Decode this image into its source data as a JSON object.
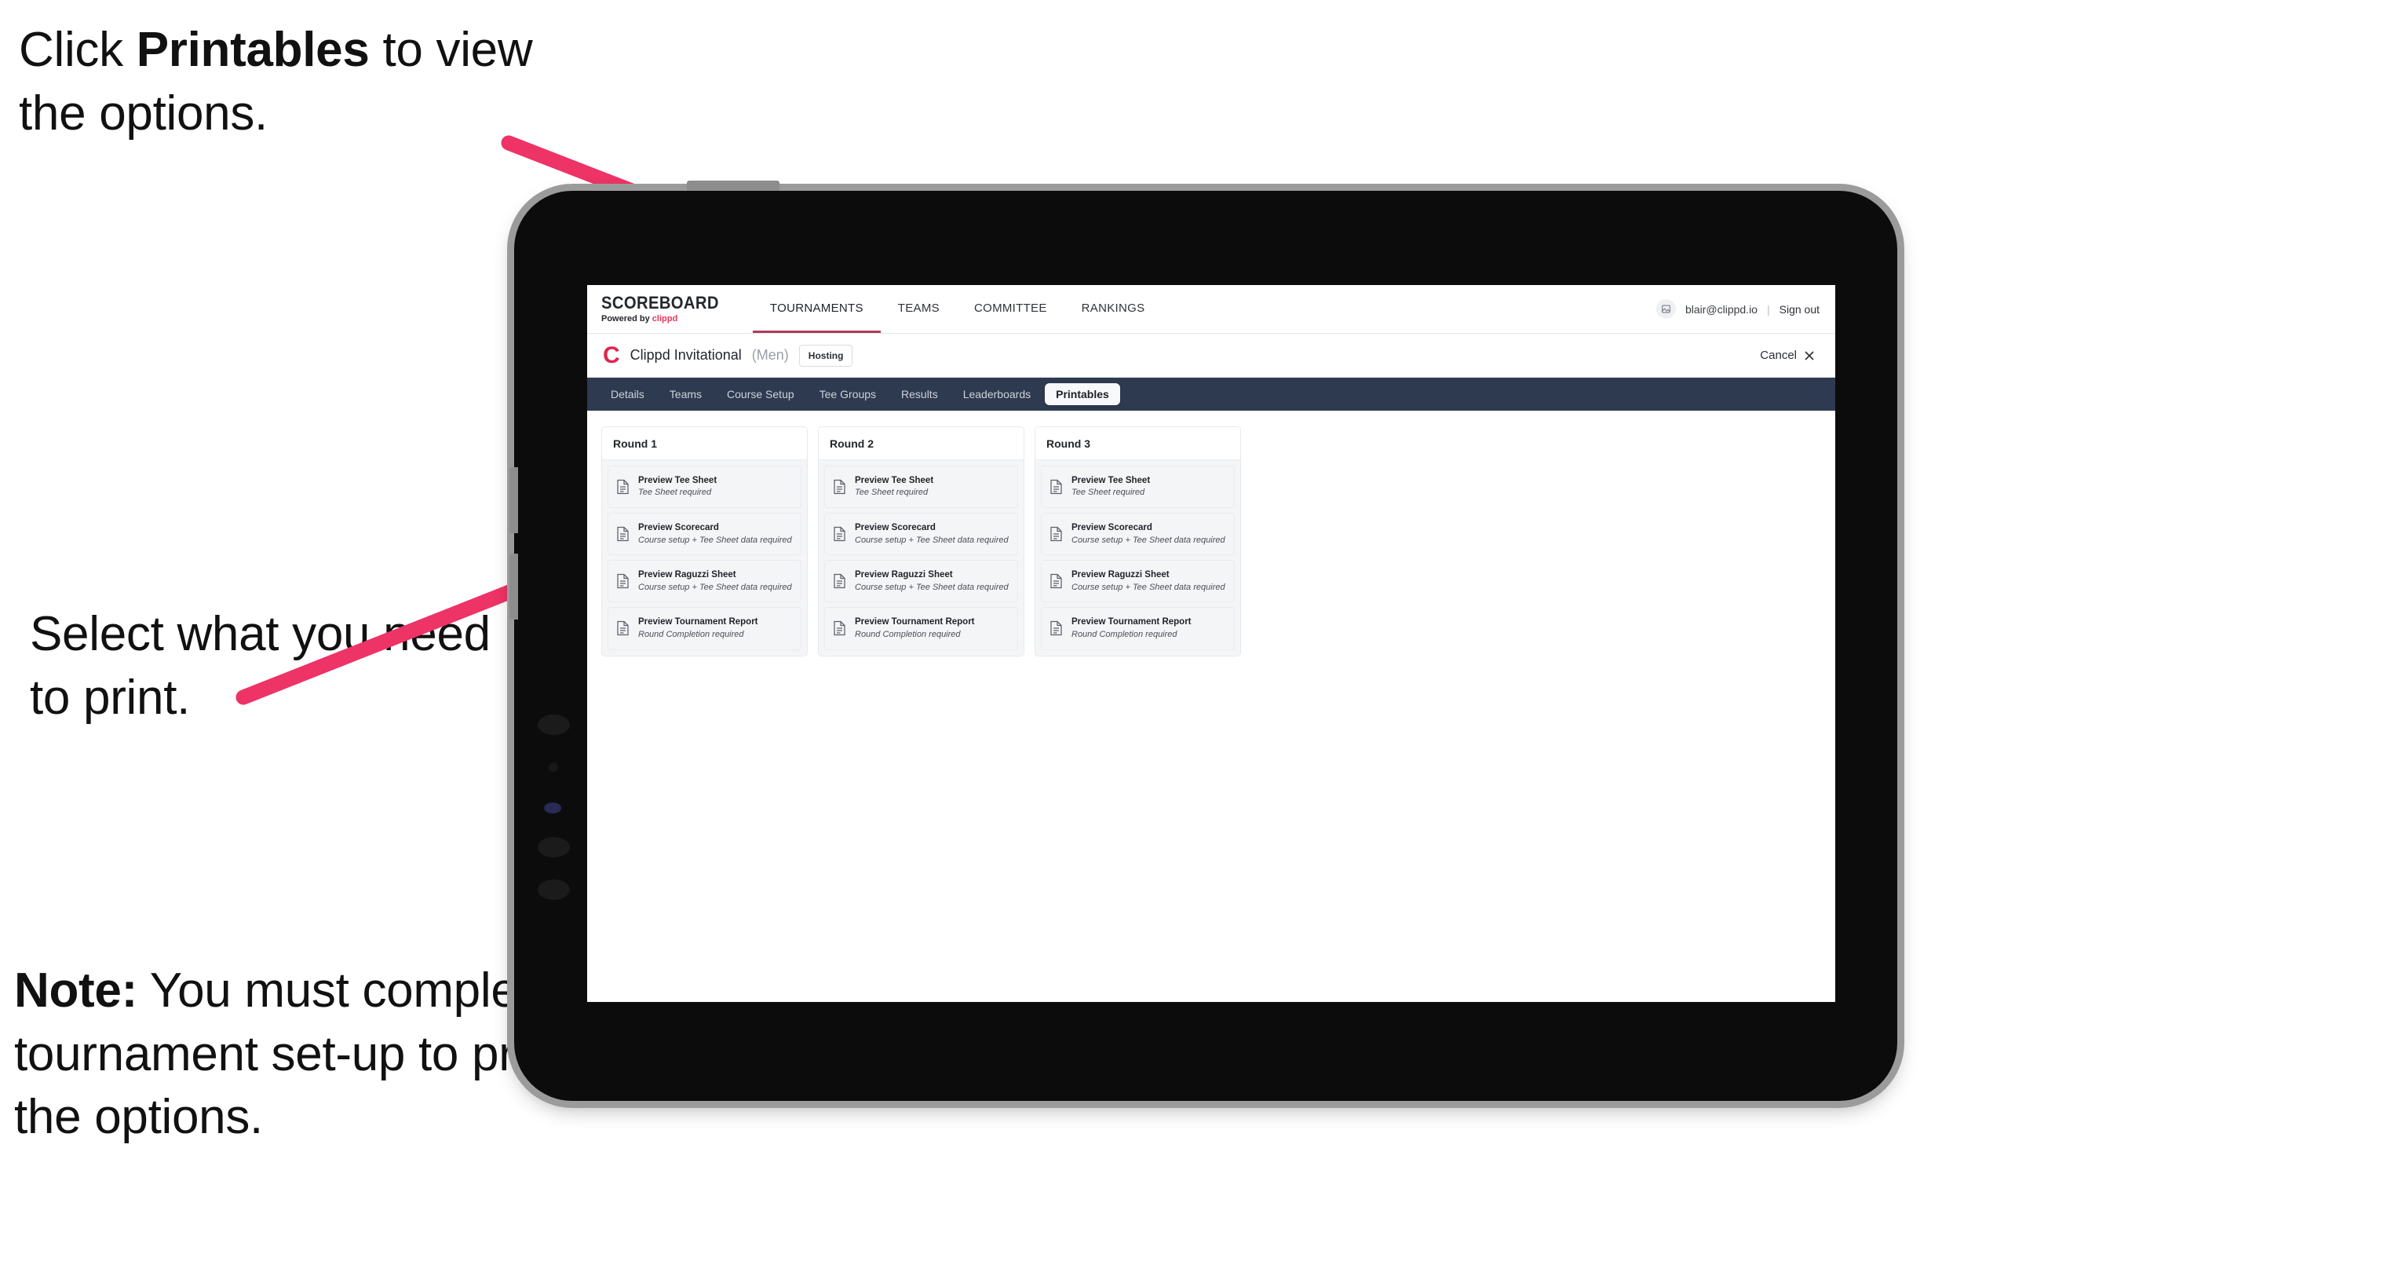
{
  "annotations": {
    "top": {
      "prefix": "Click ",
      "bold": "Printables",
      "suffix": " to view the options."
    },
    "middle": "Select what you need to print.",
    "note": {
      "bold": "Note:",
      "text": " You must complete the tournament set-up to print all the options."
    },
    "arrow_color": "#ee3366"
  },
  "app": {
    "brand": {
      "title": "SCOREBOARD",
      "powered_prefix": "Powered by ",
      "powered_brand": "clippd"
    },
    "top_nav": [
      {
        "label": "TOURNAMENTS",
        "active": true
      },
      {
        "label": "TEAMS",
        "active": false
      },
      {
        "label": "COMMITTEE",
        "active": false
      },
      {
        "label": "RANKINGS",
        "active": false
      }
    ],
    "account": {
      "avatar_icon": "user-avatar-icon",
      "email": "blair@clippd.io",
      "separator": "|",
      "sign_out": "Sign out"
    },
    "tournament": {
      "logo_mark": "C",
      "name": "Clippd Invitational",
      "gender": "(Men)",
      "status_badge": "Hosting",
      "cancel_label": "Cancel",
      "cancel_icon": "close-icon"
    },
    "sub_nav": [
      {
        "label": "Details",
        "active": false
      },
      {
        "label": "Teams",
        "active": false
      },
      {
        "label": "Course Setup",
        "active": false
      },
      {
        "label": "Tee Groups",
        "active": false
      },
      {
        "label": "Results",
        "active": false
      },
      {
        "label": "Leaderboards",
        "active": false
      },
      {
        "label": "Printables",
        "active": true
      }
    ],
    "rounds": [
      {
        "title": "Round 1",
        "items": [
          {
            "title": "Preview Tee Sheet",
            "requirement": "Tee Sheet required"
          },
          {
            "title": "Preview Scorecard",
            "requirement": "Course setup + Tee Sheet data required"
          },
          {
            "title": "Preview Raguzzi Sheet",
            "requirement": "Course setup + Tee Sheet data required"
          },
          {
            "title": "Preview Tournament Report",
            "requirement": "Round Completion required"
          }
        ]
      },
      {
        "title": "Round 2",
        "items": [
          {
            "title": "Preview Tee Sheet",
            "requirement": "Tee Sheet required"
          },
          {
            "title": "Preview Scorecard",
            "requirement": "Course setup + Tee Sheet data required"
          },
          {
            "title": "Preview Raguzzi Sheet",
            "requirement": "Course setup + Tee Sheet data required"
          },
          {
            "title": "Preview Tournament Report",
            "requirement": "Round Completion required"
          }
        ]
      },
      {
        "title": "Round 3",
        "items": [
          {
            "title": "Preview Tee Sheet",
            "requirement": "Tee Sheet required"
          },
          {
            "title": "Preview Scorecard",
            "requirement": "Course setup + Tee Sheet data required"
          },
          {
            "title": "Preview Raguzzi Sheet",
            "requirement": "Course setup + Tee Sheet data required"
          },
          {
            "title": "Preview Tournament Report",
            "requirement": "Round Completion required"
          }
        ]
      }
    ],
    "colors": {
      "subnav_bg": "#2e3a4f",
      "brand_pink": "#e8345a",
      "tournament_logo": "#e0254f",
      "active_underline": "#b03b5c"
    }
  }
}
